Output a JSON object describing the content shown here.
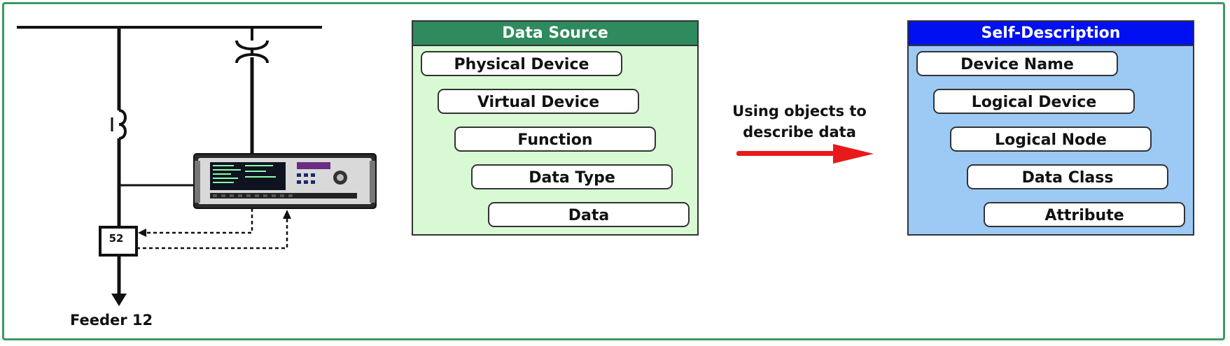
{
  "single_line": {
    "breaker_label": "52",
    "feeder_label": "Feeder 12"
  },
  "data_source": {
    "title": "Data Source",
    "items": [
      "Physical Device",
      "Virtual Device",
      "Function",
      "Data Type",
      "Data"
    ]
  },
  "arrow": {
    "line1": "Using objects to",
    "line2": "describe data",
    "color": "#e8191a"
  },
  "self_description": {
    "title": "Self-Description",
    "items": [
      "Device Name",
      "Logical Device",
      "Logical Node",
      "Data Class",
      "Attribute"
    ]
  },
  "colors": {
    "frame_border": "#3a9a62",
    "data_source_header": "#2f8a5e",
    "data_source_body": "#d8f9d4",
    "self_description_header": "#0010f0",
    "self_description_body": "#9ccaf5"
  }
}
